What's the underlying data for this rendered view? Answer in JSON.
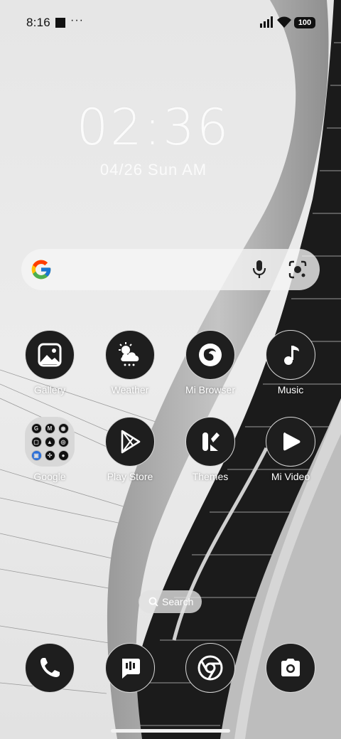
{
  "status_bar": {
    "time": "8:16",
    "more": "···",
    "battery": "100"
  },
  "clock": {
    "time": "02:36",
    "date": "04/26 Sun AM"
  },
  "google_search": {
    "logo_icon": "google-g-icon",
    "mic_icon": "microphone-icon",
    "lens_icon": "google-lens-icon"
  },
  "apps_row1": [
    {
      "label": "Gallery",
      "icon": "gallery-icon"
    },
    {
      "label": "Weather",
      "icon": "weather-icon"
    },
    {
      "label": "Mi Browser",
      "icon": "browser-icon"
    },
    {
      "label": "Music",
      "icon": "music-icon"
    }
  ],
  "apps_row2": [
    {
      "label": "Google",
      "icon": "folder-icon"
    },
    {
      "label": "Play Store",
      "icon": "play-store-icon"
    },
    {
      "label": "Themes",
      "icon": "themes-icon"
    },
    {
      "label": "Mi Video",
      "icon": "video-icon"
    }
  ],
  "search_pill": {
    "label": "Search"
  },
  "dock": [
    {
      "name": "Phone",
      "icon": "phone-icon"
    },
    {
      "name": "Messages",
      "icon": "messages-icon"
    },
    {
      "name": "Chrome",
      "icon": "chrome-icon"
    },
    {
      "name": "Camera",
      "icon": "camera-icon"
    }
  ],
  "colors": {
    "icon_bg": "#1e1e1e",
    "wallpaper_light": "#e9e9e9",
    "wallpaper_dark": "#2a2a2a"
  }
}
